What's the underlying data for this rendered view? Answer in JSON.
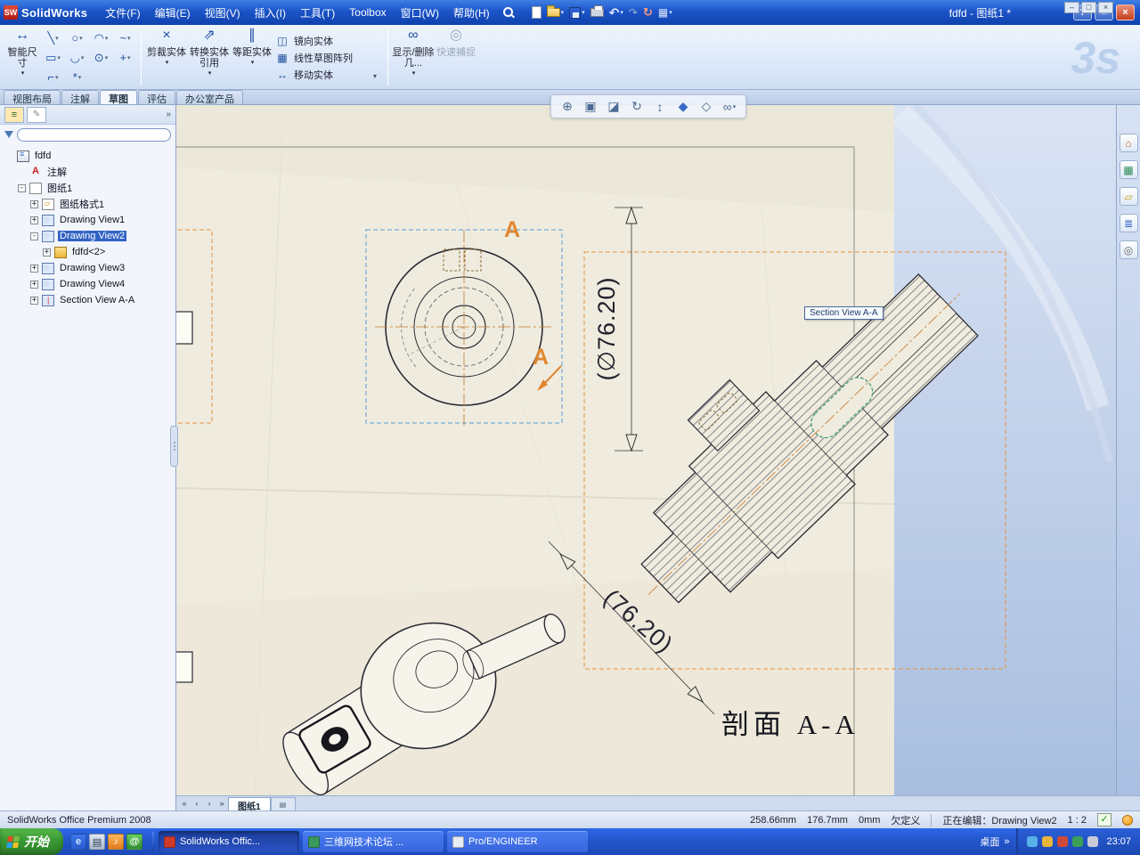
{
  "titlebar": {
    "logo": "SW",
    "app_name": "SolidWorks",
    "menus": [
      "文件(F)",
      "编辑(E)",
      "视图(V)",
      "插入(I)",
      "工具(T)",
      "Toolbox",
      "窗口(W)",
      "帮助(H)"
    ],
    "document_title": "fdfd - 图纸1 *"
  },
  "toolbar": {
    "smart_dimension": {
      "label": "智能尺寸",
      "glyph": "↔"
    },
    "sketch_tools": [
      {
        "name": "line-tool-icon",
        "glyph": "╲"
      },
      {
        "name": "circle-tool-icon",
        "glyph": "○"
      },
      {
        "name": "arc-tool-icon",
        "glyph": "◠"
      },
      {
        "name": "spline-tool-icon",
        "glyph": "~"
      },
      {
        "name": "rectangle-tool-icon",
        "glyph": "▭"
      },
      {
        "name": "slot-tool-icon",
        "glyph": "◡"
      },
      {
        "name": "ellipse-tool-icon",
        "glyph": "⊙"
      },
      {
        "name": "point-tool-icon",
        "glyph": "+"
      },
      {
        "name": "fillet-tool-icon",
        "glyph": "⌐"
      },
      {
        "name": "sketch-text-tool-icon",
        "glyph": "*"
      }
    ],
    "big_buttons": [
      {
        "name": "trim-entities-button",
        "label": "剪裁实体",
        "glyph": "×",
        "cls": ""
      },
      {
        "name": "convert-entities-button",
        "label": "转换实体引用",
        "glyph": "⇗",
        "cls": ""
      },
      {
        "name": "offset-entities-button",
        "label": "等距实体",
        "glyph": "∥",
        "cls": ""
      }
    ],
    "stack_buttons": [
      {
        "name": "mirror-entities-button",
        "label": "镜向实体",
        "glyph": "◫"
      },
      {
        "name": "linear-sketch-pattern-button",
        "label": "线性草图阵列",
        "glyph": "▦"
      },
      {
        "name": "move-entities-button",
        "label": "移动实体",
        "glyph": "↔"
      }
    ],
    "display_delete": {
      "label": "显示/删除几...",
      "glyph": "∞"
    },
    "quick_snap": {
      "label": "快速捕捉",
      "glyph": "◎"
    },
    "watermark": "3s"
  },
  "command_tabs": [
    {
      "label": "视图布局",
      "cls": ""
    },
    {
      "label": "注解",
      "cls": ""
    },
    {
      "label": "草图",
      "cls": "active"
    },
    {
      "label": "评估",
      "cls": ""
    },
    {
      "label": "办公室产品",
      "cls": ""
    }
  ],
  "feature_tree": {
    "items": [
      {
        "label": "fdfd",
        "exp": "",
        "expcls": "noexp",
        "icon": "ic-doc",
        "lvl": "lvl0",
        "sel": ""
      },
      {
        "label": "注解",
        "exp": "",
        "expcls": "noexp",
        "icon": "ic-ann",
        "lvl": "lvl1",
        "sel": ""
      },
      {
        "label": "图纸1",
        "exp": "-",
        "expcls": "",
        "icon": "ic-sheet",
        "lvl": "lvl1",
        "sel": ""
      },
      {
        "label": "图纸格式1",
        "exp": "+",
        "expcls": "",
        "icon": "ic-format",
        "lvl": "lvl2",
        "sel": ""
      },
      {
        "label": "Drawing View1",
        "exp": "+",
        "expcls": "",
        "icon": "ic-view",
        "lvl": "lvl2",
        "sel": ""
      },
      {
        "label": "Drawing View2",
        "exp": "-",
        "expcls": "",
        "icon": "ic-view",
        "lvl": "lvl2",
        "sel": "selected"
      },
      {
        "label": "fdfd<2>",
        "exp": "+",
        "expcls": "",
        "icon": "ic-part",
        "lvl": "lvl3",
        "sel": ""
      },
      {
        "label": "Drawing View3",
        "exp": "+",
        "expcls": "",
        "icon": "ic-view",
        "lvl": "lvl2",
        "sel": ""
      },
      {
        "label": "Drawing View4",
        "exp": "+",
        "expcls": "",
        "icon": "ic-view",
        "lvl": "lvl2",
        "sel": ""
      },
      {
        "label": "Section View A-A",
        "exp": "+",
        "expcls": "",
        "icon": "ic-section",
        "lvl": "lvl2",
        "sel": ""
      }
    ]
  },
  "view_toolbar": [
    {
      "name": "zoom-fit-icon",
      "glyph": "⊕",
      "cls": ""
    },
    {
      "name": "zoom-area-icon",
      "glyph": "▣",
      "cls": ""
    },
    {
      "name": "section-view-tool-icon",
      "glyph": "◪",
      "cls": ""
    },
    {
      "name": "rotate-view-icon",
      "glyph": "↻",
      "cls": ""
    },
    {
      "name": "pan-icon",
      "glyph": "↕",
      "cls": ""
    },
    {
      "name": "view-orientation-icon",
      "glyph": "◆",
      "cls": "vt-blue"
    },
    {
      "name": "display-style-icon",
      "glyph": "◇",
      "cls": ""
    },
    {
      "name": "hide-show-items-icon",
      "glyph": "∞",
      "cls": "caret"
    }
  ],
  "right_toolbar": [
    {
      "name": "home-icon",
      "glyph": "⌂",
      "cls": "ri-orange"
    },
    {
      "name": "panels-icon",
      "glyph": "▦",
      "cls": "ri-green"
    },
    {
      "name": "folder-icon",
      "glyph": "▱",
      "cls": "ri-yellow"
    },
    {
      "name": "layers-icon",
      "glyph": "≣",
      "cls": "ri-blue"
    },
    {
      "name": "bulb-icon",
      "glyph": "◎",
      "cls": "ri-gray"
    }
  ],
  "drawing": {
    "dim_diameter": "(∅76.20)",
    "dim_section": "(76.20)",
    "section_label": "剖面 A-A",
    "section_letter": "A",
    "tooltip": "Section View A-A"
  },
  "sheet_bar": {
    "tab": "图纸1"
  },
  "statusbar": {
    "left": "SolidWorks Office Premium 2008",
    "x": "258.66mm",
    "y": "176.7mm",
    "z": "0mm",
    "state": "欠定义",
    "editing": "正在编辑：Drawing View2",
    "scale": "1 : 2"
  },
  "taskbar": {
    "start": "开始",
    "quick_launch": [
      {
        "name": "ie-icon",
        "glyph": "e",
        "cls": "ql-blue"
      },
      {
        "name": "show-desktop-icon",
        "glyph": "▤",
        "cls": "ql-gray"
      },
      {
        "name": "media-player-icon",
        "glyph": "♪",
        "cls": "ql-orange"
      },
      {
        "name": "messenger-icon",
        "glyph": "@",
        "cls": "ql-green"
      }
    ],
    "windows": [
      {
        "label": "SolidWorks Offic...",
        "cls": "active",
        "icls": "tw-red"
      },
      {
        "label": "三维网技术论坛 ...",
        "cls": "",
        "icls": "tw-green"
      },
      {
        "label": "Pro/ENGINEER",
        "cls": "",
        "icls": "tw-white"
      }
    ],
    "desktop": "桌面",
    "tray_icons": [
      {
        "cls": "t1"
      },
      {
        "cls": "t2"
      },
      {
        "cls": "t3"
      },
      {
        "cls": "t4"
      },
      {
        "cls": "t5"
      }
    ],
    "clock": "23:07"
  }
}
